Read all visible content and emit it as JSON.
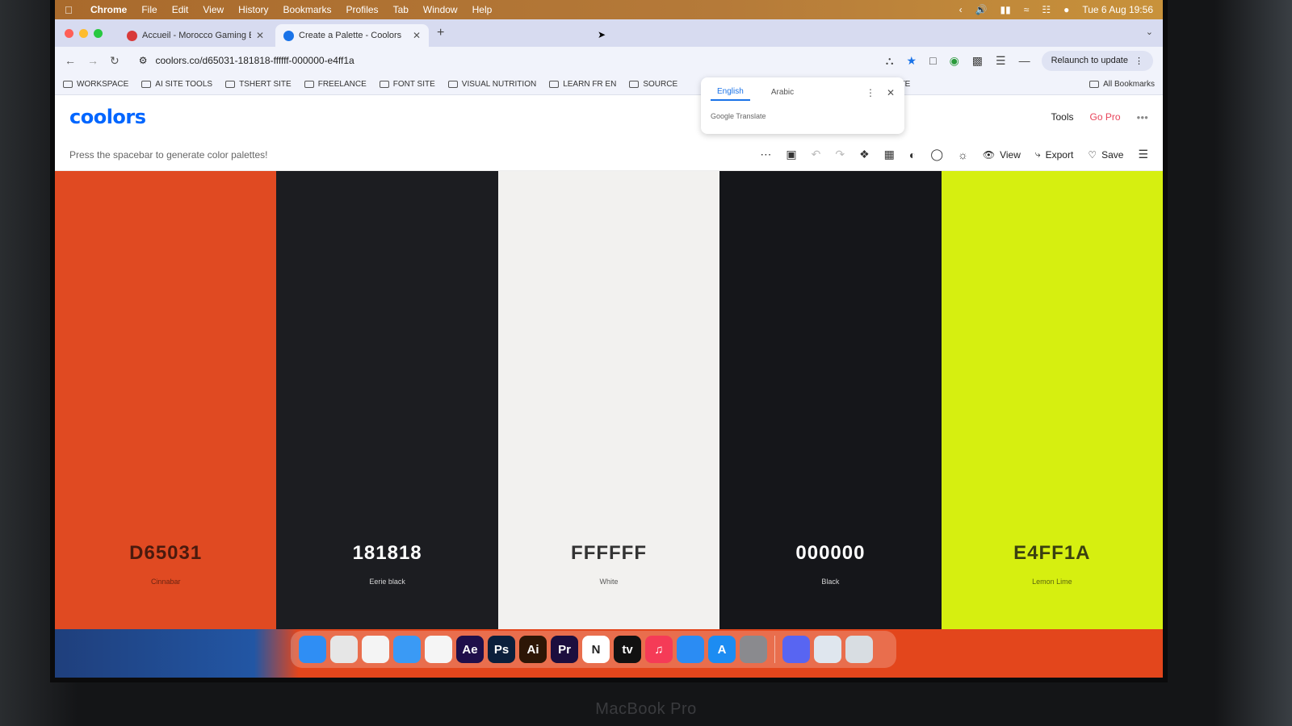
{
  "menubar": {
    "app_name": "Chrome",
    "menus": [
      "File",
      "Edit",
      "View",
      "History",
      "Bookmarks",
      "Profiles",
      "Tab",
      "Window",
      "Help"
    ],
    "datetime": "Tue 6 Aug  19:56"
  },
  "tabs": [
    {
      "title": "Accueil - Morocco Gaming E...",
      "favicon_color": "#d83a3a",
      "active": false
    },
    {
      "title": "Create a Palette - Coolors",
      "favicon_color": "#1a73e8",
      "active": true
    }
  ],
  "toolbar": {
    "url": "coolors.co/d65031-181818-ffffff-000000-e4ff1a",
    "relaunch_label": "Relaunch to update"
  },
  "bookmarks": {
    "items": [
      "WORKSPACE",
      "AI SITE TOOLS",
      "TSHERT SITE",
      "FREELANCE",
      "FONT SITE",
      "VISUAL NUTRITION",
      "LEARN FR EN",
      "SOURCE"
    ],
    "partial": "SITE",
    "all_label": "All Bookmarks"
  },
  "translate_popup": {
    "lang_on": "English",
    "lang_off": "Arabic",
    "brand": "Google Translate"
  },
  "coolors": {
    "logo": "coolors",
    "tools_label": "Tools",
    "gopro_label": "Go Pro",
    "hint": "Press the spacebar to generate color palettes!",
    "view_label": "View",
    "export_label": "Export",
    "save_label": "Save",
    "accent_color": "#0066ff",
    "gopro_color": "#e8445a"
  },
  "palette": [
    {
      "hex": "D65031",
      "name": "Cinnabar",
      "color": "#e04a22",
      "text_color": "#4a1a0e"
    },
    {
      "hex": "181818",
      "name": "Eerie black",
      "color": "#1c1d21",
      "text_color": "#ffffff"
    },
    {
      "hex": "FFFFFF",
      "name": "White",
      "color": "#f2f1ef",
      "text_color": "#333333"
    },
    {
      "hex": "000000",
      "name": "Black",
      "color": "#15161a",
      "text_color": "#ffffff"
    },
    {
      "hex": "E4FF1A",
      "name": "Lemon Lime",
      "color": "#d6ef10",
      "text_color": "#3a4010"
    }
  ],
  "dock": [
    {
      "icon": "finder-icon",
      "label": "",
      "bg": "#2f8ef4"
    },
    {
      "icon": "launchpad-icon",
      "label": "",
      "bg": "#e6e6e6"
    },
    {
      "icon": "chrome-icon",
      "label": "",
      "bg": "#f4f4f4"
    },
    {
      "icon": "mail-icon",
      "label": "",
      "bg": "#3a9af5"
    },
    {
      "icon": "photos-icon",
      "label": "",
      "bg": "#f5f5f5"
    },
    {
      "icon": "after-effects-icon",
      "label": "Ae",
      "bg": "#1f0f4a"
    },
    {
      "icon": "photoshop-icon",
      "label": "Ps",
      "bg": "#0b1f3b"
    },
    {
      "icon": "illustrator-icon",
      "label": "Ai",
      "bg": "#2d1606"
    },
    {
      "icon": "premiere-icon",
      "label": "Pr",
      "bg": "#1c0e3e"
    },
    {
      "icon": "notion-icon",
      "label": "N",
      "bg": "#ffffff"
    },
    {
      "icon": "apple-tv-icon",
      "label": "tv",
      "bg": "#111111"
    },
    {
      "icon": "music-icon",
      "label": "♫",
      "bg": "#f53b57"
    },
    {
      "icon": "safari-icon",
      "label": "",
      "bg": "#2b8cf3"
    },
    {
      "icon": "app-store-icon",
      "label": "A",
      "bg": "#1c8cf2"
    },
    {
      "icon": "system-settings-icon",
      "label": "",
      "bg": "#8a8a8e"
    },
    {
      "icon": "discord-icon",
      "label": "",
      "bg": "#5865f2"
    },
    {
      "icon": "finder-window-icon",
      "label": "",
      "bg": "#dfe6ee"
    },
    {
      "icon": "trash-icon",
      "label": "",
      "bg": "#d8dde2"
    }
  ],
  "laptop_label": "MacBook Pro"
}
